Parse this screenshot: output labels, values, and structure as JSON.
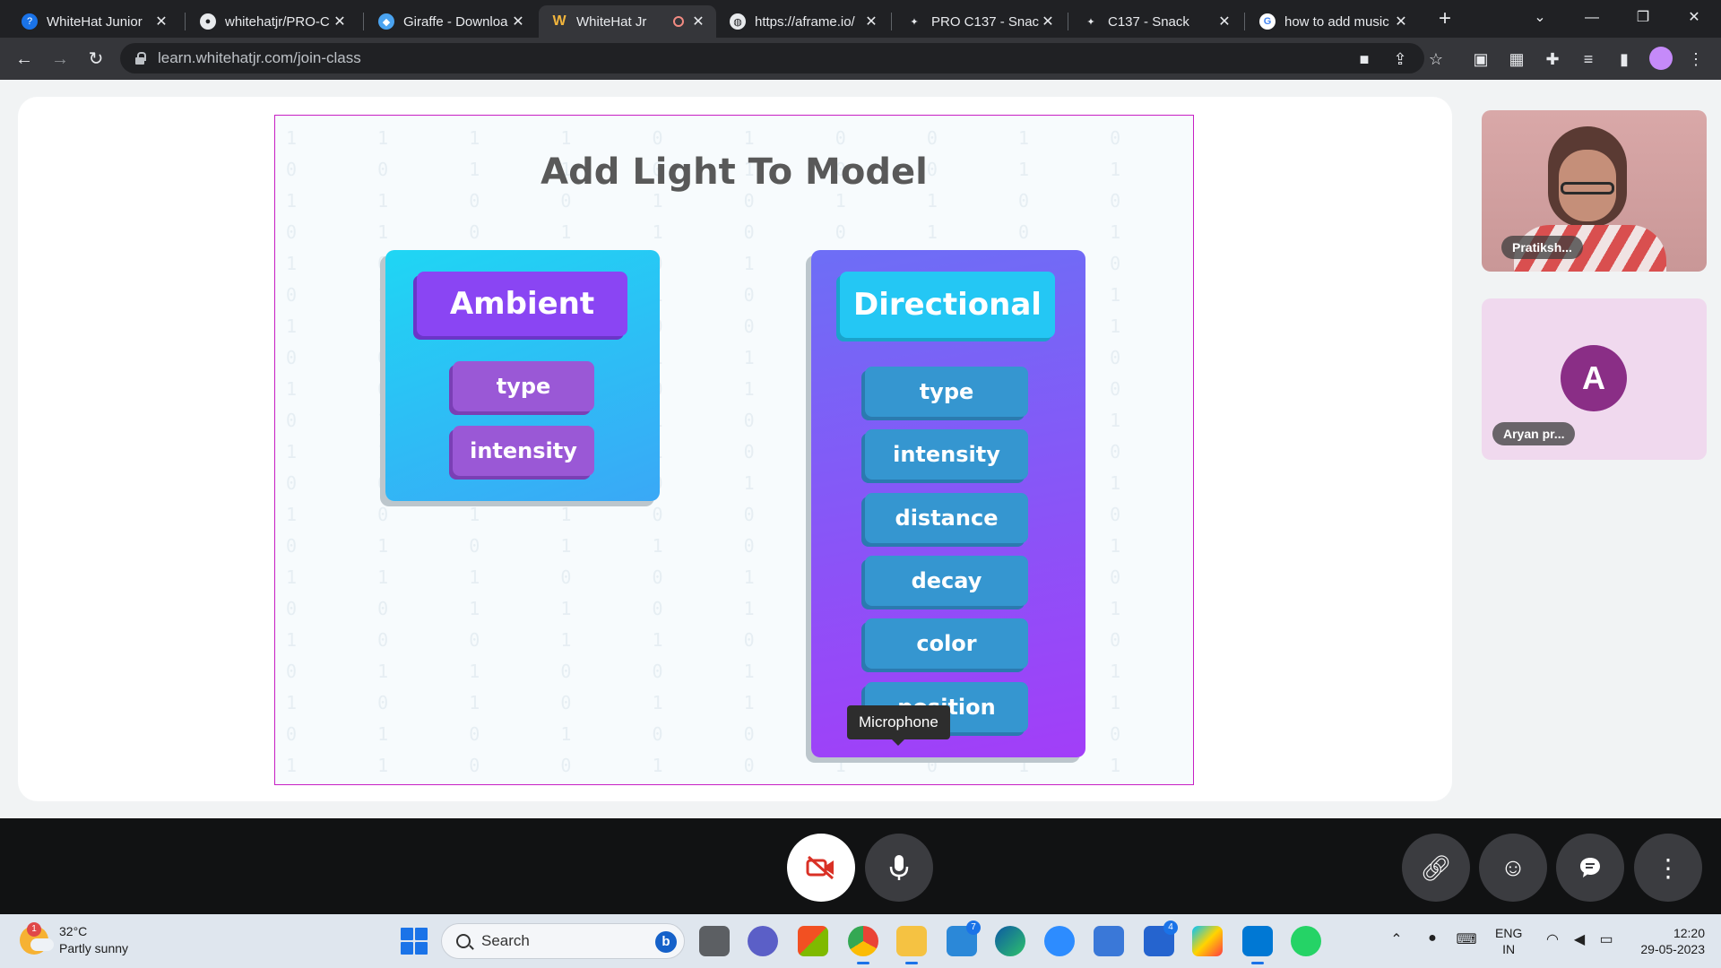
{
  "browser": {
    "tabs": [
      {
        "title": "WhiteHat Junior",
        "favicon": "whitehat-icon",
        "active": false
      },
      {
        "title": "whitehatjr/PRO-C",
        "favicon": "github-icon",
        "active": false
      },
      {
        "title": "Giraffe - Downloa",
        "favicon": "giraffe-icon",
        "active": false
      },
      {
        "title": "WhiteHat Jr",
        "favicon": "whitehat-w-icon",
        "active": true,
        "recording": true
      },
      {
        "title": "https://aframe.io/",
        "favicon": "globe-icon",
        "active": false
      },
      {
        "title": "PRO C137 - Snacl",
        "favicon": "snack-icon",
        "active": false
      },
      {
        "title": "C137 - Snack",
        "favicon": "snack-icon",
        "active": false
      },
      {
        "title": "how to add music",
        "favicon": "google-icon",
        "active": false
      }
    ],
    "url": "learn.whitehatjr.com/join-class"
  },
  "slide": {
    "title": "Add Light To Model",
    "ambient": {
      "heading": "Ambient",
      "properties": [
        "type",
        "intensity"
      ]
    },
    "directional": {
      "heading": "Directional",
      "properties": [
        "type",
        "intensity",
        "distance",
        "decay",
        "color",
        "position"
      ]
    }
  },
  "participants": [
    {
      "name": "Pratiksh...",
      "type": "video"
    },
    {
      "name": "Aryan pr...",
      "initial": "A",
      "type": "avatar"
    }
  ],
  "tooltip": "Microphone",
  "colors": {
    "ambient_card": "#1fd6f4",
    "directional_card": "#8a4ef7",
    "slide_border": "#c71fc4",
    "avatar_bg": "#8a2e86"
  },
  "taskbar": {
    "weather_temp": "32°C",
    "weather_desc": "Partly sunny",
    "weather_badge": "1",
    "search_label": "Search",
    "mail_badge": "7",
    "todo_badge": "4",
    "lang_top": "ENG",
    "lang_bottom": "IN",
    "time": "12:20",
    "date": "29-05-2023"
  }
}
